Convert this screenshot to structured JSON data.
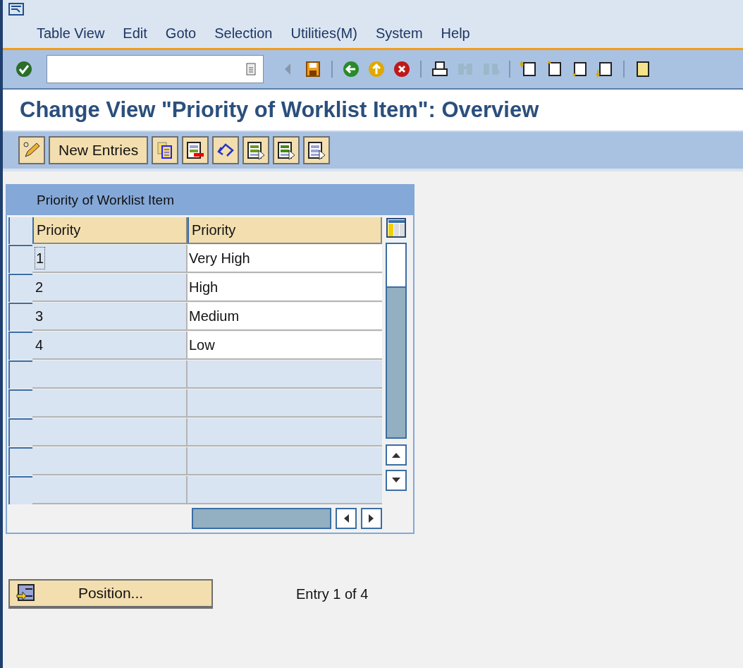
{
  "menu_bar": {
    "items": [
      "Table View",
      "Edit",
      "Goto",
      "Selection",
      "Utilities(M)",
      "System",
      "Help"
    ]
  },
  "title": "Change View \"Priority of Worklist Item\": Overview",
  "app_toolbar": {
    "buttons": [
      {
        "label": "New Entries"
      }
    ]
  },
  "table": {
    "title": "Priority of Worklist Item",
    "columns": [
      "Priority",
      "Priority"
    ],
    "rows": [
      {
        "key": "1",
        "text": "Very High",
        "focused": true
      },
      {
        "key": "2",
        "text": "High",
        "focused": false
      },
      {
        "key": "3",
        "text": "Medium",
        "focused": false
      },
      {
        "key": "4",
        "text": "Low",
        "focused": false
      }
    ]
  },
  "position_button": {
    "label": "Position..."
  },
  "entry_info": "Entry 1 of 4"
}
